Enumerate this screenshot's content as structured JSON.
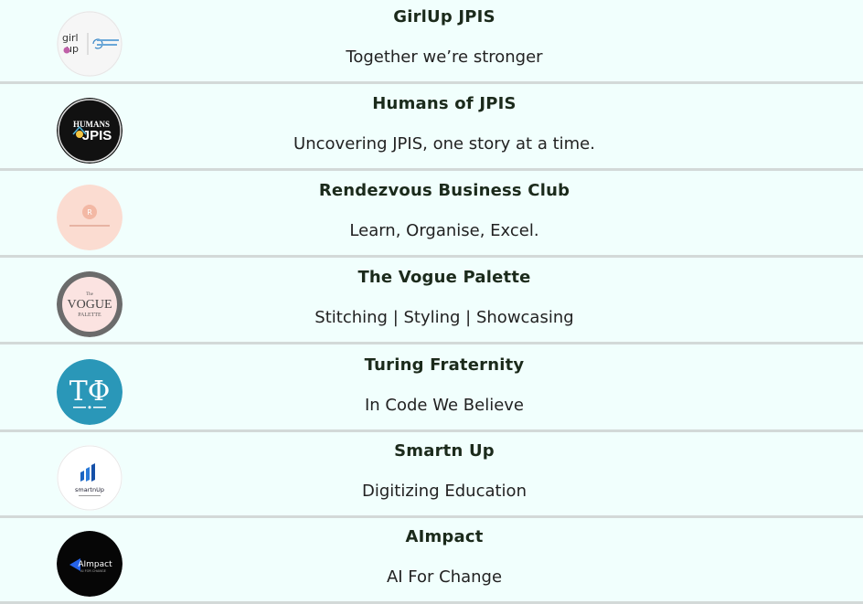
{
  "clubs": [
    {
      "name": "GirlUp JPIS",
      "tagline": "Together we’re stronger",
      "logo_icon": "girlup-logo-icon",
      "logo_text": "girl up"
    },
    {
      "name": "Humans of JPIS",
      "tagline": "Uncovering JPIS, one story at a time.",
      "logo_icon": "humans-of-jpis-logo-icon",
      "logo_text": "HUMANS JPIS"
    },
    {
      "name": "Rendezvous Business Club",
      "tagline": "Learn, Organise, Excel.",
      "logo_icon": "rendezvous-logo-icon",
      "logo_text": "R"
    },
    {
      "name": "The Vogue Palette",
      "tagline": "Stitching | Styling | Showcasing",
      "logo_icon": "vogue-palette-logo-icon",
      "logo_text": "VOGUE"
    },
    {
      "name": "Turing Fraternity",
      "tagline": "In Code We Believe",
      "logo_icon": "turing-fraternity-logo-icon",
      "logo_text": "TΦ"
    },
    {
      "name": "Smartn Up",
      "tagline": "Digitizing Education",
      "logo_icon": "smartn-up-logo-icon",
      "logo_text": "smartnUp"
    },
    {
      "name": "AImpact",
      "tagline": "AI For Change",
      "logo_icon": "aimpact-logo-icon",
      "logo_text": "AImpact"
    }
  ],
  "colors": {
    "background": "#f0fffd",
    "divider": "#d3d9d8",
    "text": "#1e2a1e"
  }
}
